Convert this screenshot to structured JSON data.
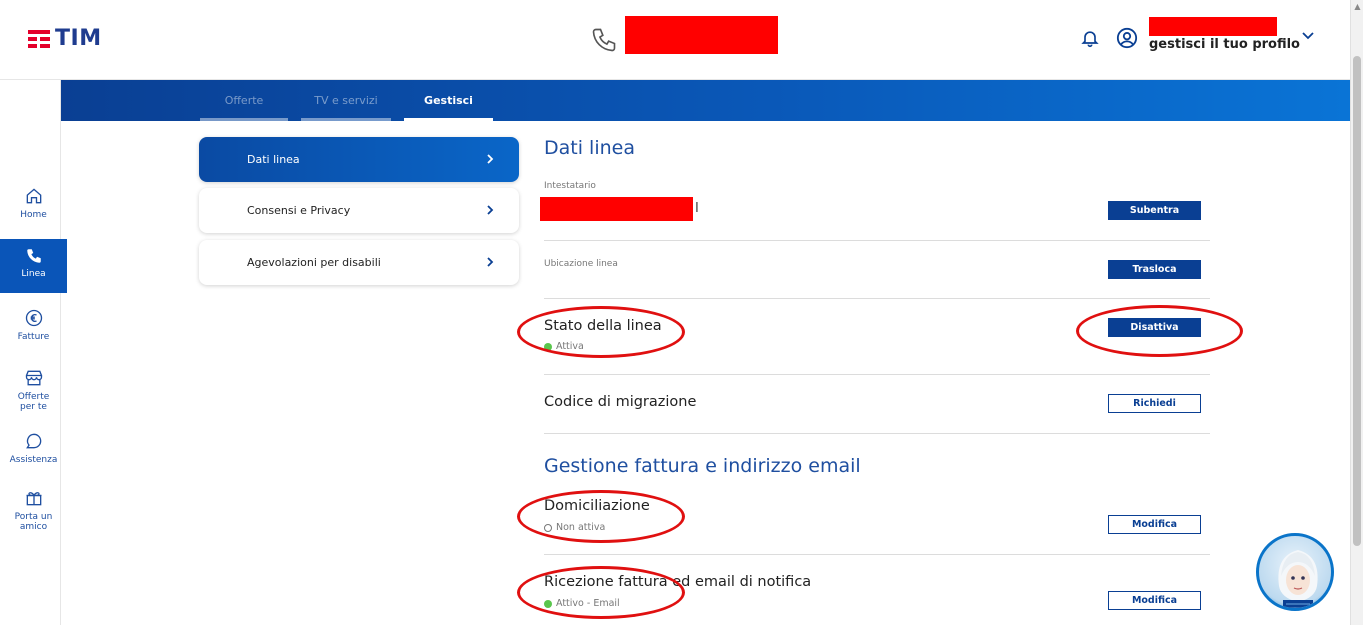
{
  "header": {
    "brand": "TIM",
    "profile_link": "gestisci il tuo profilo"
  },
  "tabs": [
    {
      "label": "Offerte",
      "active": false
    },
    {
      "label": "TV e servizi",
      "active": false
    },
    {
      "label": "Gestisci",
      "active": true
    }
  ],
  "leftnav": [
    {
      "label": "Home",
      "icon": "home-icon",
      "active": false
    },
    {
      "label": "Linea",
      "icon": "phone-icon",
      "active": true
    },
    {
      "label": "Fatture",
      "icon": "euro-icon",
      "active": false
    },
    {
      "label": "Offerte per te",
      "icon": "store-icon",
      "active": false
    },
    {
      "label": "Assistenza",
      "icon": "chat-icon",
      "active": false
    },
    {
      "label": "Porta un amico",
      "icon": "gift-icon",
      "active": false
    }
  ],
  "submenu": [
    {
      "label": "Dati linea",
      "active": true
    },
    {
      "label": "Consensi e Privacy",
      "active": false
    },
    {
      "label": "Agevolazioni per disabili",
      "active": false
    }
  ],
  "dati_linea": {
    "title": "Dati linea",
    "intestatario_label": "Intestatario",
    "intestatario_cursor": "I",
    "subentra_button": "Subentra",
    "ubicazione_label": "Ubicazione linea",
    "trasloca_button": "Trasloca",
    "stato_title": "Stato della linea",
    "stato_value": "Attiva",
    "disattiva_button": "Disattiva",
    "codice_title": "Codice di migrazione",
    "richiedi_button": "Richiedi"
  },
  "fattura": {
    "title": "Gestione fattura e indirizzo email",
    "domiciliazione_title": "Domiciliazione",
    "domiciliazione_status": "Non attiva",
    "domiciliazione_button": "Modifica",
    "ricezione_title": "Ricezione fattura ed email di notifica",
    "ricezione_status": "Attivo - Email",
    "ricezione_button": "Modifica"
  },
  "colors": {
    "brand_blue": "#0a3f93",
    "brand_red": "#e4002b",
    "status_green": "#5ac64d",
    "annotation_red": "#e01010",
    "redaction_red": "#ff0000"
  }
}
